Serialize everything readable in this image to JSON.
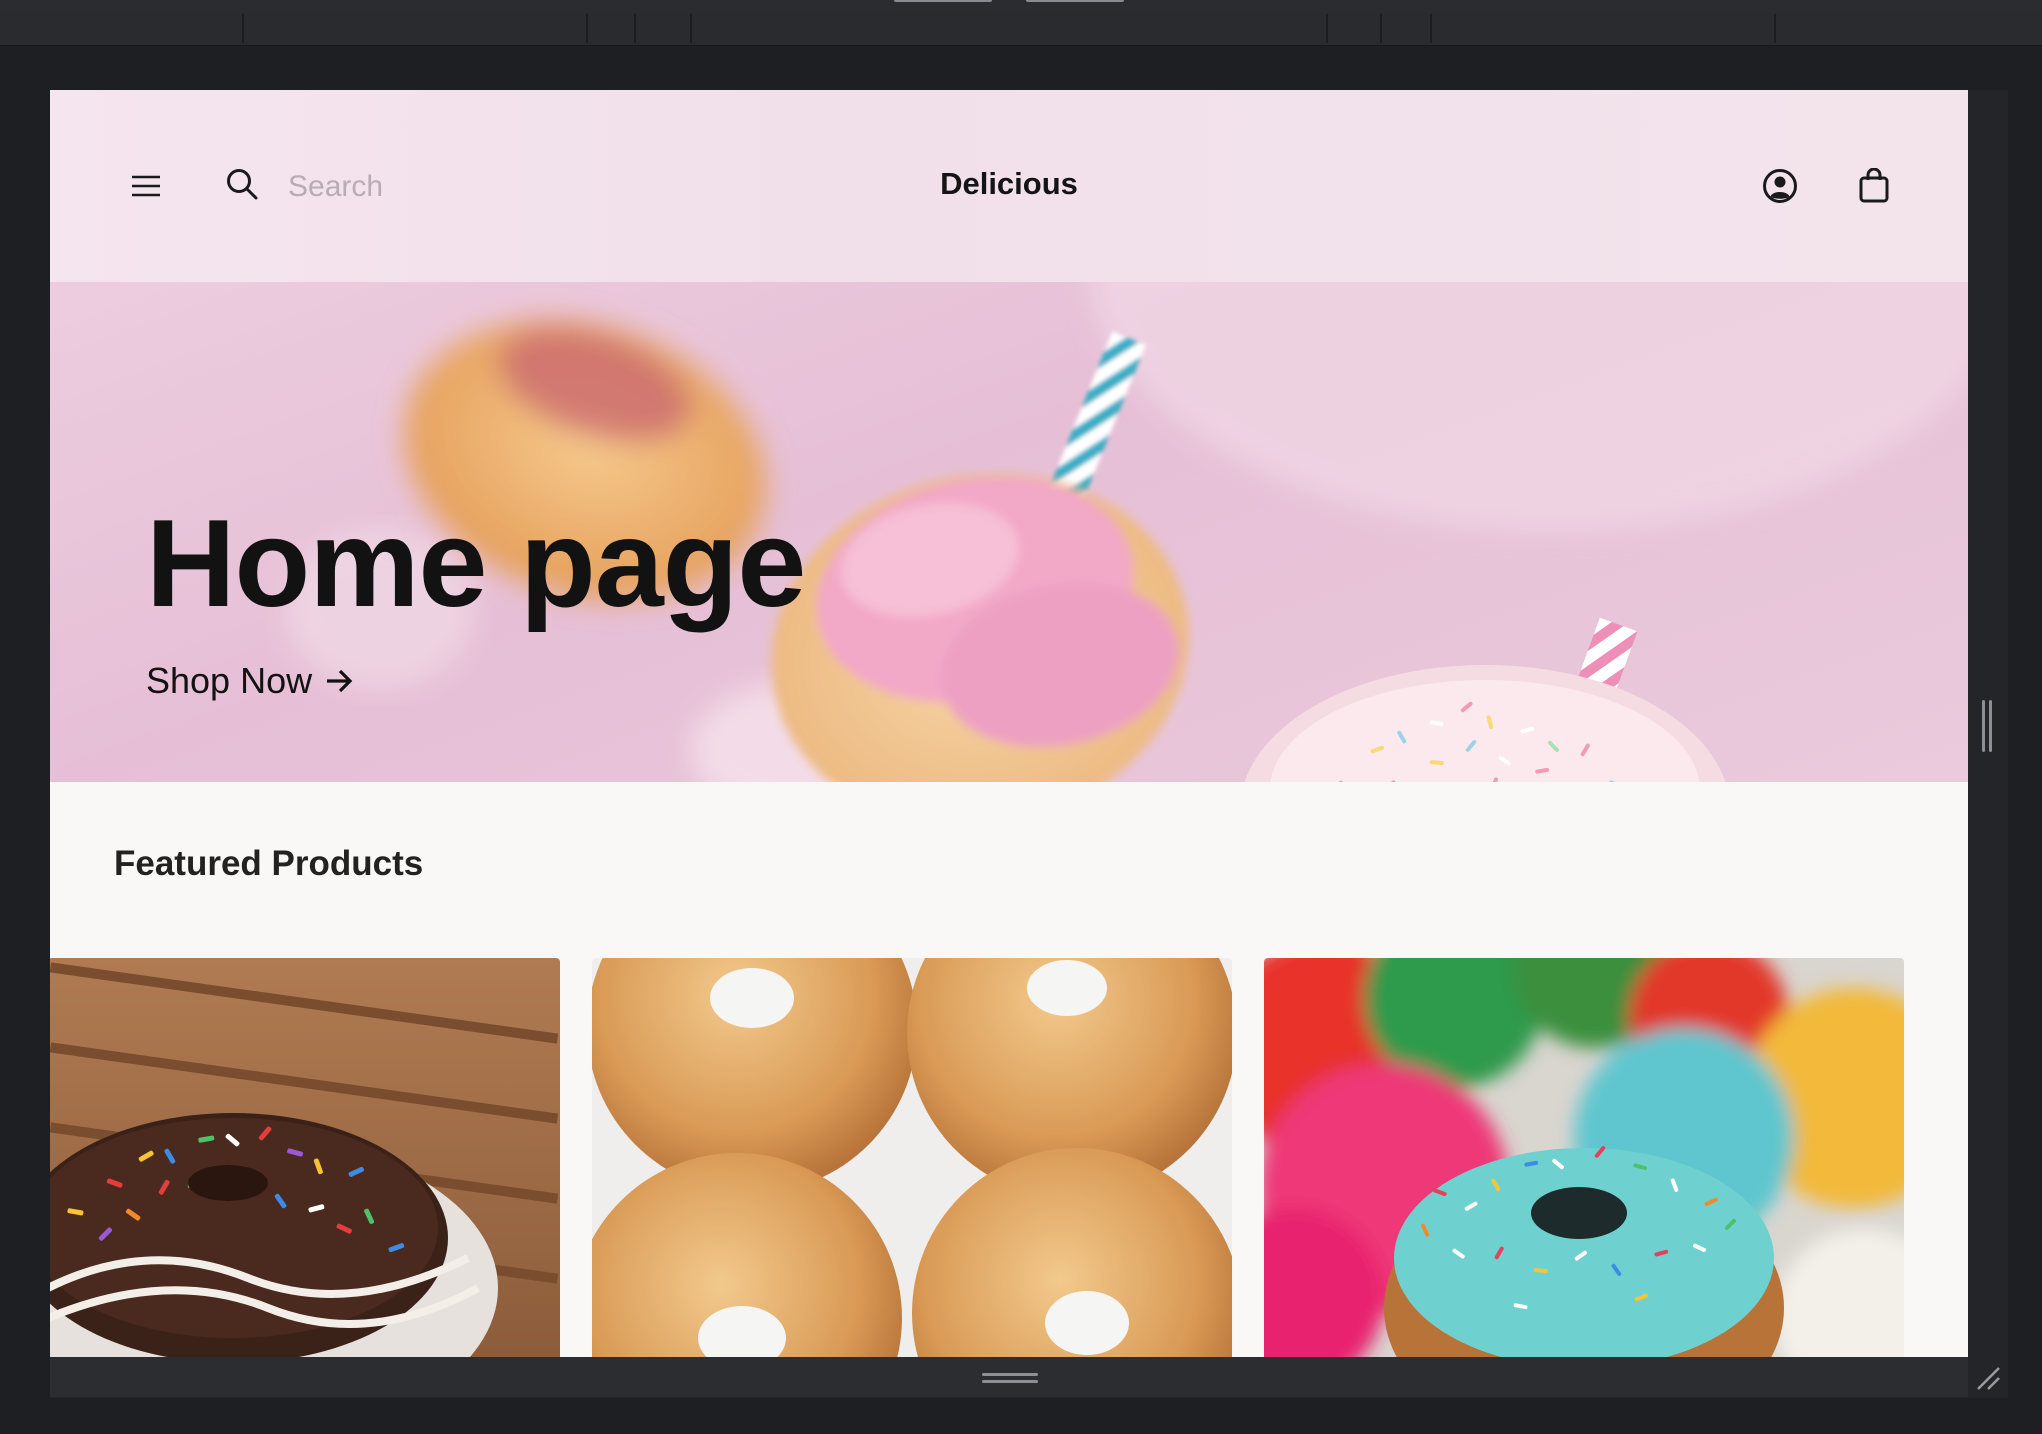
{
  "header": {
    "menu_icon": "hamburger-menu-icon",
    "search_icon": "search-icon",
    "search_placeholder": "Search",
    "search_value": "",
    "brand": "Delicious",
    "account_icon": "account-circle-icon",
    "cart_icon": "shopping-bag-icon"
  },
  "hero": {
    "title": "Home page",
    "cta_label": "Shop Now",
    "cta_icon": "arrow-right-icon",
    "image": "pink-donuts-with-straws-photo"
  },
  "featured": {
    "title": "Featured Products",
    "products": [
      {
        "image": "rainbow-sprinkle-chocolate-donut-photo"
      },
      {
        "image": "glazed-donuts-box-photo"
      },
      {
        "image": "blue-sprinkle-donut-photo"
      }
    ]
  },
  "colors": {
    "header_bg": "#f3e3ec",
    "hero_bg": "#e9c9dc",
    "page_bg": "#f9f8f6",
    "text": "#121212",
    "editor_bg": "#1e1f22"
  }
}
